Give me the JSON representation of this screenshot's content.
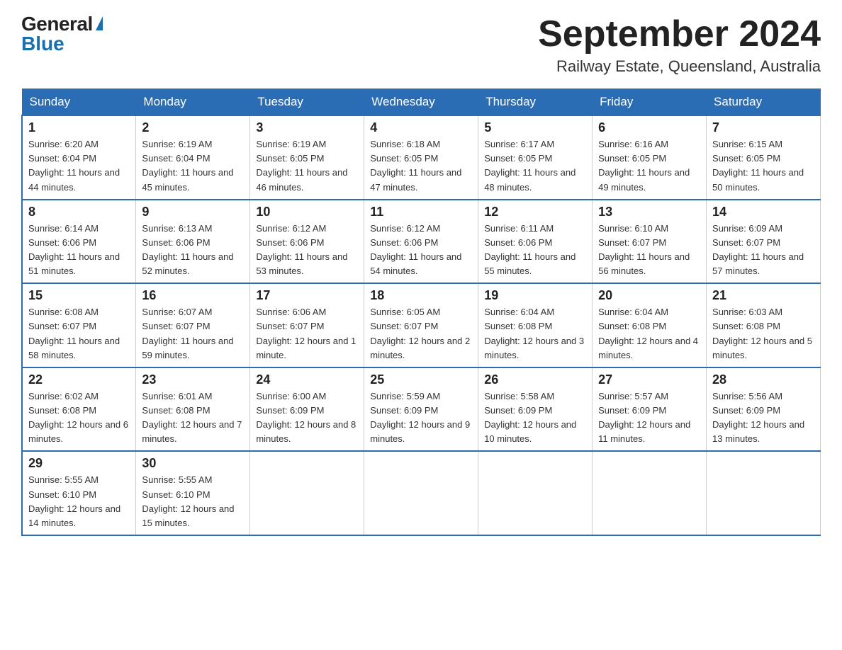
{
  "logo": {
    "general": "General",
    "blue": "Blue"
  },
  "title": {
    "month": "September 2024",
    "location": "Railway Estate, Queensland, Australia"
  },
  "weekdays": [
    "Sunday",
    "Monday",
    "Tuesday",
    "Wednesday",
    "Thursday",
    "Friday",
    "Saturday"
  ],
  "weeks": [
    [
      {
        "day": "1",
        "sunrise": "6:20 AM",
        "sunset": "6:04 PM",
        "daylight": "11 hours and 44 minutes."
      },
      {
        "day": "2",
        "sunrise": "6:19 AM",
        "sunset": "6:04 PM",
        "daylight": "11 hours and 45 minutes."
      },
      {
        "day": "3",
        "sunrise": "6:19 AM",
        "sunset": "6:05 PM",
        "daylight": "11 hours and 46 minutes."
      },
      {
        "day": "4",
        "sunrise": "6:18 AM",
        "sunset": "6:05 PM",
        "daylight": "11 hours and 47 minutes."
      },
      {
        "day": "5",
        "sunrise": "6:17 AM",
        "sunset": "6:05 PM",
        "daylight": "11 hours and 48 minutes."
      },
      {
        "day": "6",
        "sunrise": "6:16 AM",
        "sunset": "6:05 PM",
        "daylight": "11 hours and 49 minutes."
      },
      {
        "day": "7",
        "sunrise": "6:15 AM",
        "sunset": "6:05 PM",
        "daylight": "11 hours and 50 minutes."
      }
    ],
    [
      {
        "day": "8",
        "sunrise": "6:14 AM",
        "sunset": "6:06 PM",
        "daylight": "11 hours and 51 minutes."
      },
      {
        "day": "9",
        "sunrise": "6:13 AM",
        "sunset": "6:06 PM",
        "daylight": "11 hours and 52 minutes."
      },
      {
        "day": "10",
        "sunrise": "6:12 AM",
        "sunset": "6:06 PM",
        "daylight": "11 hours and 53 minutes."
      },
      {
        "day": "11",
        "sunrise": "6:12 AM",
        "sunset": "6:06 PM",
        "daylight": "11 hours and 54 minutes."
      },
      {
        "day": "12",
        "sunrise": "6:11 AM",
        "sunset": "6:06 PM",
        "daylight": "11 hours and 55 minutes."
      },
      {
        "day": "13",
        "sunrise": "6:10 AM",
        "sunset": "6:07 PM",
        "daylight": "11 hours and 56 minutes."
      },
      {
        "day": "14",
        "sunrise": "6:09 AM",
        "sunset": "6:07 PM",
        "daylight": "11 hours and 57 minutes."
      }
    ],
    [
      {
        "day": "15",
        "sunrise": "6:08 AM",
        "sunset": "6:07 PM",
        "daylight": "11 hours and 58 minutes."
      },
      {
        "day": "16",
        "sunrise": "6:07 AM",
        "sunset": "6:07 PM",
        "daylight": "11 hours and 59 minutes."
      },
      {
        "day": "17",
        "sunrise": "6:06 AM",
        "sunset": "6:07 PM",
        "daylight": "12 hours and 1 minute."
      },
      {
        "day": "18",
        "sunrise": "6:05 AM",
        "sunset": "6:07 PM",
        "daylight": "12 hours and 2 minutes."
      },
      {
        "day": "19",
        "sunrise": "6:04 AM",
        "sunset": "6:08 PM",
        "daylight": "12 hours and 3 minutes."
      },
      {
        "day": "20",
        "sunrise": "6:04 AM",
        "sunset": "6:08 PM",
        "daylight": "12 hours and 4 minutes."
      },
      {
        "day": "21",
        "sunrise": "6:03 AM",
        "sunset": "6:08 PM",
        "daylight": "12 hours and 5 minutes."
      }
    ],
    [
      {
        "day": "22",
        "sunrise": "6:02 AM",
        "sunset": "6:08 PM",
        "daylight": "12 hours and 6 minutes."
      },
      {
        "day": "23",
        "sunrise": "6:01 AM",
        "sunset": "6:08 PM",
        "daylight": "12 hours and 7 minutes."
      },
      {
        "day": "24",
        "sunrise": "6:00 AM",
        "sunset": "6:09 PM",
        "daylight": "12 hours and 8 minutes."
      },
      {
        "day": "25",
        "sunrise": "5:59 AM",
        "sunset": "6:09 PM",
        "daylight": "12 hours and 9 minutes."
      },
      {
        "day": "26",
        "sunrise": "5:58 AM",
        "sunset": "6:09 PM",
        "daylight": "12 hours and 10 minutes."
      },
      {
        "day": "27",
        "sunrise": "5:57 AM",
        "sunset": "6:09 PM",
        "daylight": "12 hours and 11 minutes."
      },
      {
        "day": "28",
        "sunrise": "5:56 AM",
        "sunset": "6:09 PM",
        "daylight": "12 hours and 13 minutes."
      }
    ],
    [
      {
        "day": "29",
        "sunrise": "5:55 AM",
        "sunset": "6:10 PM",
        "daylight": "12 hours and 14 minutes."
      },
      {
        "day": "30",
        "sunrise": "5:55 AM",
        "sunset": "6:10 PM",
        "daylight": "12 hours and 15 minutes."
      },
      null,
      null,
      null,
      null,
      null
    ]
  ]
}
